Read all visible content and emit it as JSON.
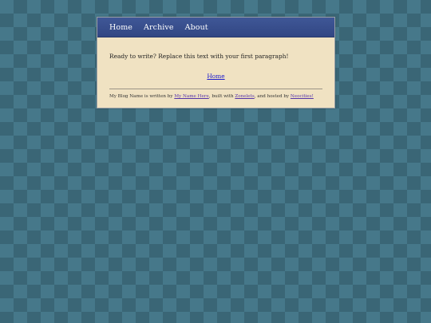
{
  "nav": {
    "items": [
      {
        "label": "Home"
      },
      {
        "label": "Archive"
      },
      {
        "label": "About"
      }
    ]
  },
  "main": {
    "intro": "Ready to write? Replace this text with your first paragraph!",
    "home_link": "Home"
  },
  "footer": {
    "prefix": "My Blog Name is written by ",
    "author_link": "My Name Here",
    "middle": ", built with ",
    "builder_link": "Zonelets",
    "middle2": ", and hosted by ",
    "host_link": "Neocities!"
  },
  "colors": {
    "background": "#46788a",
    "nav": "#3f5797",
    "panel": "#f0e2c2",
    "link": "#1a1acc"
  }
}
